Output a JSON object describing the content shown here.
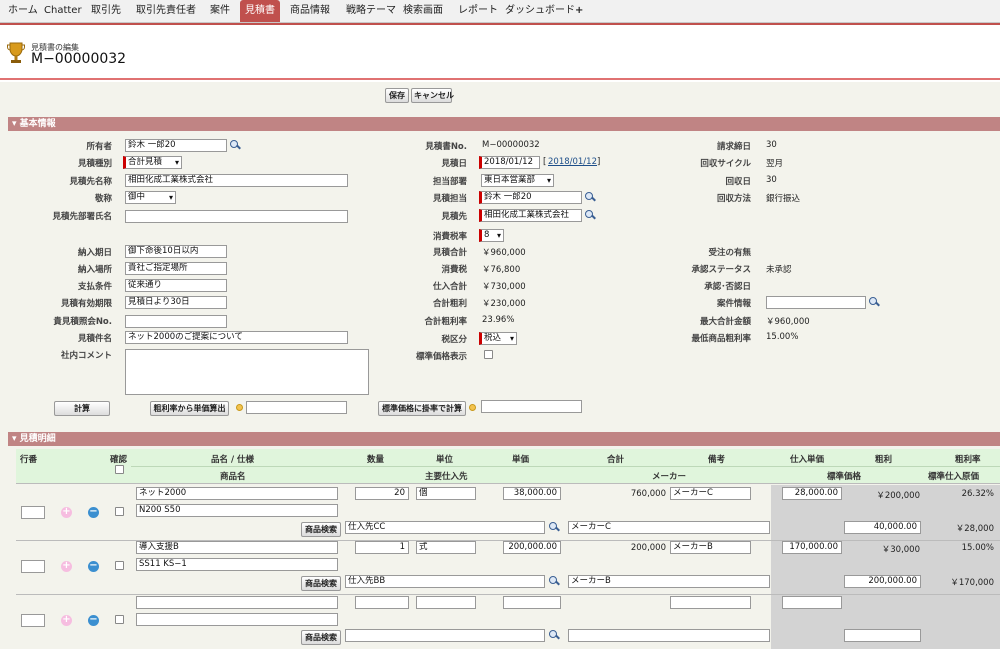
{
  "tabs": [
    "ホーム",
    "Chatter",
    "取引先",
    "取引先責任者",
    "案件",
    "見積書",
    "商品情報",
    "戦略テーマ",
    "検索画面",
    "レポート",
    "ダッシュボード",
    "+"
  ],
  "header": {
    "edit_label": "見積書の編集",
    "quote_no": "M−00000032"
  },
  "buttons": {
    "save": "保存",
    "cancel": "キャンセル",
    "calc": "計算",
    "margin_calc": "粗利率から単価算出",
    "std_calc": "標準価格に掛率で計算",
    "product_search": "商品検索"
  },
  "section_basic": "基本情報",
  "section_detail": "見積明細",
  "left": [
    {
      "label": "所有者",
      "value": "鈴木 一郎20"
    },
    {
      "label": "見積種別",
      "value": "合計見積"
    },
    {
      "label": "見積先名称",
      "value": "相田化成工業株式会社"
    },
    {
      "label": "敬称",
      "value": "御中"
    },
    {
      "label": "見積先部署氏名",
      "value": ""
    },
    {
      "label": "納入期日",
      "value": "御下命後10日以内"
    },
    {
      "label": "納入場所",
      "value": "貴社ご指定場所"
    },
    {
      "label": "支払条件",
      "value": "従来通り"
    },
    {
      "label": "見積有効期限",
      "value": "見積日より30日"
    },
    {
      "label": "貴見積照会No.",
      "value": ""
    },
    {
      "label": "見積件名",
      "value": "ネット2000のご提案について"
    },
    {
      "label": "社内コメント",
      "value": ""
    }
  ],
  "mid": [
    {
      "label": "見積書No.",
      "value": "M−00000032"
    },
    {
      "label": "見積日",
      "value": "2018/01/12",
      "link": "2018/01/12"
    },
    {
      "label": "担当部署",
      "value": "東日本営業部"
    },
    {
      "label": "見積担当",
      "value": "鈴木 一郎20"
    },
    {
      "label": "見積先",
      "value": "相田化成工業株式会社"
    },
    {
      "label": "消費税率",
      "value": "8"
    },
    {
      "label": "見積合計",
      "value": "￥960,000"
    },
    {
      "label": "消費税",
      "value": "￥76,800"
    },
    {
      "label": "仕入合計",
      "value": "￥730,000"
    },
    {
      "label": "合計粗利",
      "value": "￥230,000"
    },
    {
      "label": "合計粗利率",
      "value": "23.96%"
    },
    {
      "label": "税区分",
      "value": "税込"
    },
    {
      "label": "標準価格表示",
      "value": ""
    }
  ],
  "right": [
    {
      "label": "請求締日",
      "value": "30"
    },
    {
      "label": "回収サイクル",
      "value": "翌月"
    },
    {
      "label": "回収日",
      "value": "30"
    },
    {
      "label": "回収方法",
      "value": "銀行振込"
    },
    {
      "label": "受注の有無",
      "value": ""
    },
    {
      "label": "承認ステータス",
      "value": "未承認"
    },
    {
      "label": "承認･否認日",
      "value": ""
    },
    {
      "label": "案件情報",
      "value": ""
    },
    {
      "label": "最大合計金額",
      "value": "￥960,000"
    },
    {
      "label": "最低商品粗利率",
      "value": "15.00%"
    }
  ],
  "detail_header": {
    "row1": [
      "行番",
      "確認",
      "品名 / 仕様",
      "数量",
      "単位",
      "単価",
      "合計",
      "備考",
      "仕入単価",
      "粗利",
      "粗利率"
    ],
    "row2": [
      "商品名",
      "主要仕入先",
      "メーカー",
      "標準価格",
      "標準仕入原価"
    ]
  },
  "items": [
    {
      "name": "ネット2000",
      "spec": "N200 S50",
      "qty": "20",
      "unit": "個",
      "price": "38,000.00",
      "total": "760,000",
      "note": "メーカーC",
      "cost": "28,000.00",
      "profit": "￥200,000",
      "rate": "26.32%",
      "supplier": "仕入先CC",
      "maker": "メーカーC",
      "std_price": "40,000.00",
      "std_cost": "￥28,000"
    },
    {
      "name": "導入支援B",
      "spec": "SS11 KS−1",
      "qty": "1",
      "unit": "式",
      "price": "200,000.00",
      "total": "200,000",
      "note": "メーカーB",
      "cost": "170,000.00",
      "profit": "￥30,000",
      "rate": "15.00%",
      "supplier": "仕入先BB",
      "maker": "メーカーB",
      "std_price": "200,000.00",
      "std_cost": "￥170,000"
    },
    {
      "name": "",
      "spec": "",
      "qty": "",
      "unit": "",
      "price": "",
      "total": "",
      "note": "",
      "cost": "",
      "profit": "",
      "rate": "",
      "supplier": "",
      "maker": "",
      "std_price": "",
      "std_cost": ""
    }
  ],
  "colors": {
    "accent": "#c0504d",
    "section": "#c08484",
    "required": "#cc0000"
  }
}
